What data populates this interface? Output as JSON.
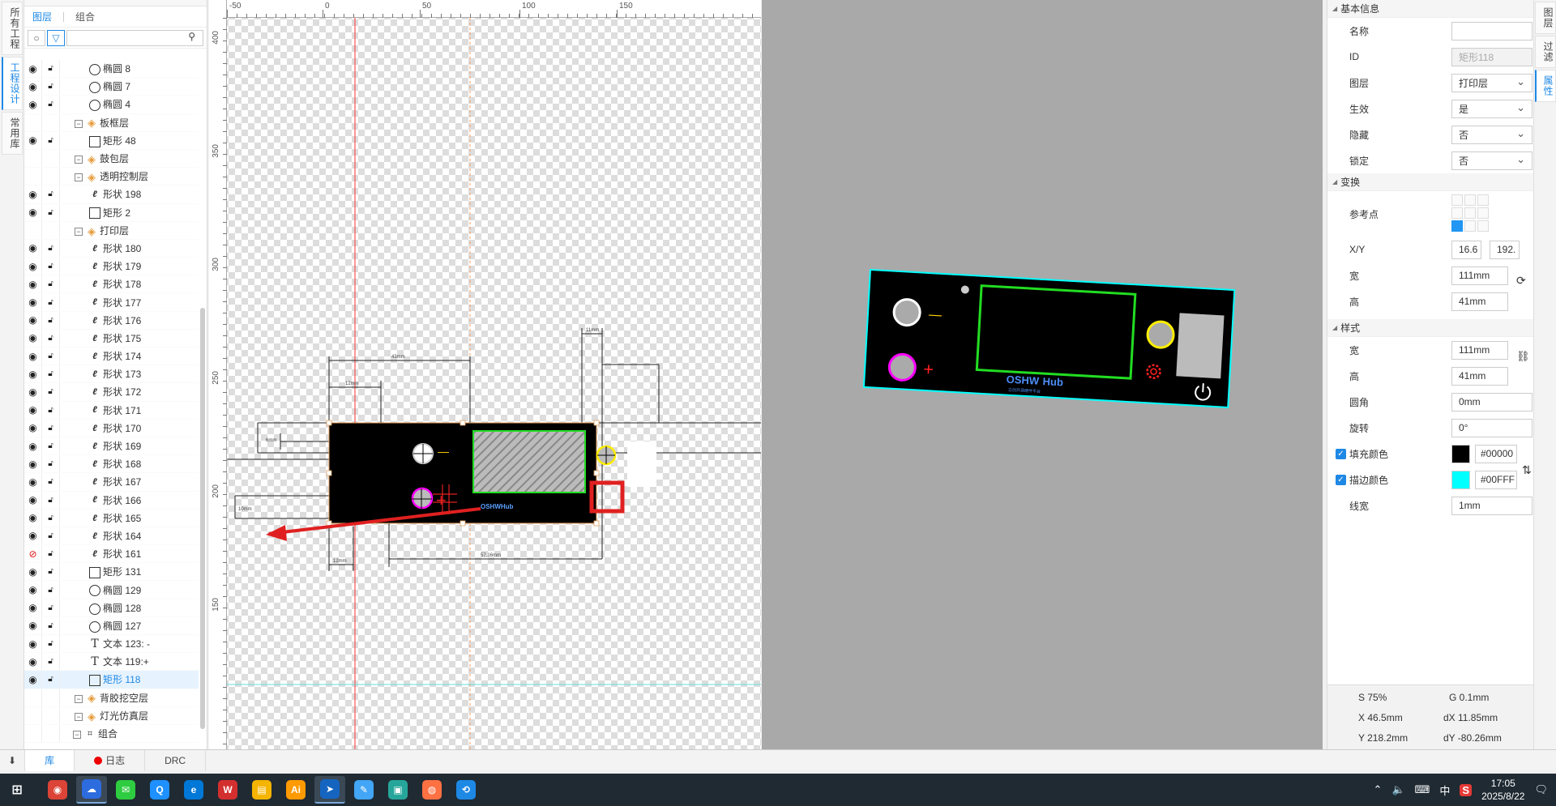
{
  "left_tabs": [
    "所有工程",
    "工程设计",
    "常用库"
  ],
  "left_tabs_active": 1,
  "layer_panel": {
    "subtabs": [
      "图层",
      "组合"
    ],
    "active_subtab": 0,
    "search_placeholder": "",
    "rows": [
      {
        "name": "椭圆 8",
        "type": "circle",
        "level": 2,
        "eye": true
      },
      {
        "name": "椭圆 7",
        "type": "circle",
        "level": 2,
        "eye": true
      },
      {
        "name": "椭圆 4",
        "type": "circle",
        "level": 2,
        "eye": true
      },
      {
        "name": "板框层",
        "type": "layer",
        "level": 1,
        "eye": false
      },
      {
        "name": "矩形 48",
        "type": "rect",
        "level": 2,
        "eye": true
      },
      {
        "name": "鼓包层",
        "type": "layer",
        "level": 1,
        "eye": false
      },
      {
        "name": "透明控制层",
        "type": "layer",
        "level": 1,
        "eye": false
      },
      {
        "name": "形状 198",
        "type": "shape",
        "level": 2,
        "eye": true
      },
      {
        "name": "矩形 2",
        "type": "rect",
        "level": 2,
        "eye": true
      },
      {
        "name": "打印层",
        "type": "layer",
        "level": 1,
        "eye": false
      },
      {
        "name": "形状 180",
        "type": "shape",
        "level": 2,
        "eye": true
      },
      {
        "name": "形状 179",
        "type": "shape",
        "level": 2,
        "eye": true
      },
      {
        "name": "形状 178",
        "type": "shape",
        "level": 2,
        "eye": true
      },
      {
        "name": "形状 177",
        "type": "shape",
        "level": 2,
        "eye": true
      },
      {
        "name": "形状 176",
        "type": "shape",
        "level": 2,
        "eye": true
      },
      {
        "name": "形状 175",
        "type": "shape",
        "level": 2,
        "eye": true
      },
      {
        "name": "形状 174",
        "type": "shape",
        "level": 2,
        "eye": true
      },
      {
        "name": "形状 173",
        "type": "shape",
        "level": 2,
        "eye": true
      },
      {
        "name": "形状 172",
        "type": "shape",
        "level": 2,
        "eye": true
      },
      {
        "name": "形状 171",
        "type": "shape",
        "level": 2,
        "eye": true
      },
      {
        "name": "形状 170",
        "type": "shape",
        "level": 2,
        "eye": true
      },
      {
        "name": "形状 169",
        "type": "shape",
        "level": 2,
        "eye": true
      },
      {
        "name": "形状 168",
        "type": "shape",
        "level": 2,
        "eye": true
      },
      {
        "name": "形状 167",
        "type": "shape",
        "level": 2,
        "eye": true
      },
      {
        "name": "形状 166",
        "type": "shape",
        "level": 2,
        "eye": true
      },
      {
        "name": "形状 165",
        "type": "shape",
        "level": 2,
        "eye": true
      },
      {
        "name": "形状 164",
        "type": "shape",
        "level": 2,
        "eye": true
      },
      {
        "name": "形状 161",
        "type": "shape",
        "level": 2,
        "eye": "hidden"
      },
      {
        "name": "矩形 131",
        "type": "rect",
        "level": 2,
        "eye": true
      },
      {
        "name": "椭圆 129",
        "type": "circle",
        "level": 2,
        "eye": true
      },
      {
        "name": "椭圆 128",
        "type": "circle",
        "level": 2,
        "eye": true
      },
      {
        "name": "椭圆 127",
        "type": "circle",
        "level": 2,
        "eye": true
      },
      {
        "name": "文本 123: -",
        "type": "text",
        "level": 2,
        "eye": true
      },
      {
        "name": "文本 119:+",
        "type": "text",
        "level": 2,
        "eye": true
      },
      {
        "name": "矩形 118",
        "type": "rect",
        "level": 2,
        "eye": true,
        "selected": true
      },
      {
        "name": "背胶挖空层",
        "type": "layer",
        "level": 1,
        "eye": false
      },
      {
        "name": "灯光仿真层",
        "type": "layer",
        "level": 1,
        "eye": false
      },
      {
        "name": "组合",
        "type": "group",
        "level": 0,
        "eye": false
      }
    ]
  },
  "ruler": {
    "top": [
      "-50",
      "0",
      "50",
      "100",
      "150"
    ],
    "left": [
      "400",
      "350",
      "300",
      "250",
      "200",
      "150"
    ]
  },
  "canvas": {
    "panel_logo": "OSHWHub",
    "minus": "—",
    "plus": "+",
    "dims": [
      "43mm",
      "12mm",
      "11mm",
      "6mm",
      "10mm",
      "12mm",
      "57.16mm"
    ]
  },
  "preview": {
    "logo_main": "OSHW",
    "logo_hub": "Hub",
    "logo_sub": "立创开源硬件平台",
    "minus": "—",
    "plus": "+"
  },
  "props": {
    "basic_header": "基本信息",
    "name_label": "名称",
    "name_value": "",
    "id_label": "ID",
    "id_value": "矩形118",
    "layer_label": "图层",
    "layer_value": "打印层",
    "effect_label": "生效",
    "effect_value": "是",
    "hide_label": "隐藏",
    "hide_value": "否",
    "lock_label": "锁定",
    "lock_value": "否",
    "transform_header": "变换",
    "ref_label": "参考点",
    "xy_label": "X/Y",
    "x_value": "16.6",
    "y_value": "192.",
    "w_label": "宽",
    "w_value": "111mm",
    "h_label": "高",
    "h_value": "41mm",
    "style_header": "样式",
    "sw_label": "宽",
    "sw_value": "111mm",
    "sh_label": "高",
    "sh_value": "41mm",
    "radius_label": "圆角",
    "radius_value": "0mm",
    "rotate_label": "旋转",
    "rotate_value": "0°",
    "fill_label": "填充颜色",
    "fill_value": "#00000",
    "stroke_label": "描边颜色",
    "stroke_value": "#00FFF",
    "linew_label": "线宽",
    "linew_value": "1mm"
  },
  "status": {
    "s": "S  75%",
    "g": "G  0.1mm",
    "x": "X  46.5mm",
    "dx": "dX  11.85mm",
    "y": "Y  218.2mm",
    "dy": "dY  -80.26mm"
  },
  "right_tabs": [
    "图层",
    "过滤",
    "属性"
  ],
  "right_tabs_active": 2,
  "bottom_tabs": [
    "库",
    "日志",
    "DRC"
  ],
  "bottom_active": 0,
  "taskbar": {
    "apps": [
      "Chrome",
      "LCEDA",
      "WeChat",
      "QQ浏览器",
      "Edge",
      "WPS",
      "文件",
      "Illustrator",
      "向日葵",
      "笔记",
      "微信输入",
      "Firefox",
      "百度网盘"
    ],
    "tray_lang": "中",
    "time": "17:05",
    "date": "2025/8/22"
  },
  "colors": {
    "accent": "#1e88e5",
    "panel_fill": "#000000",
    "panel_stroke": "#00FFFF",
    "green": "#22dd22",
    "yellow": "#ffee00",
    "magenta": "#ff00ff",
    "red": "#e02020"
  }
}
